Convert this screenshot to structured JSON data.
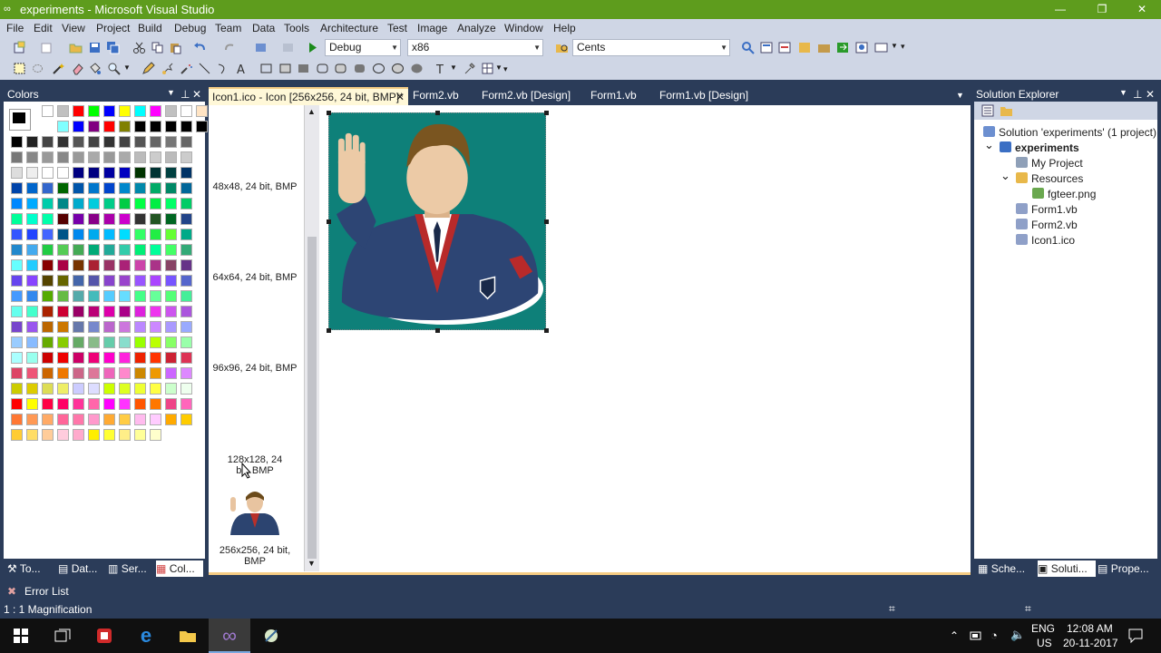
{
  "window": {
    "title": "experiments - Microsoft Visual Studio",
    "logo_icon": "vs-infinity-icon",
    "controls": {
      "minimize": "—",
      "restore": "❐",
      "close": "✕"
    }
  },
  "menu": [
    "File",
    "Edit",
    "View",
    "Project",
    "Build",
    "Debug",
    "Team",
    "Data",
    "Tools",
    "Architecture",
    "Test",
    "Image",
    "Analyze",
    "Window",
    "Help"
  ],
  "toolbar": {
    "config": "Debug",
    "platform": "x86",
    "find": "Cents"
  },
  "colors_panel": {
    "title": "Colors",
    "foreground": "#000000",
    "background": "#ffffff",
    "tabs": [
      "To...",
      "Dat...",
      "Ser...",
      "Col..."
    ],
    "palette": [
      [
        "#ffffff",
        "#c0c0c0",
        "#ff0000",
        "#00ff00",
        "#0000ff",
        "#ffff00",
        "#00ffff",
        "#ff00ff",
        "#c0c0c0",
        "#ffffff",
        "#ffe4c4"
      ],
      [
        "#80ffff",
        "#0000ff",
        "#800080",
        "#ff0000",
        "#808000",
        "#000000",
        "#000000",
        "#000000",
        "#000000",
        "#000000"
      ],
      [
        "#000000",
        "#222222",
        "#444444",
        "#333333",
        "#555555",
        "#444444",
        "#333333",
        "#444444",
        "#555555",
        "#666666",
        "#777777",
        "#666666"
      ],
      [
        "#777777",
        "#888888",
        "#999999",
        "#888888",
        "#999999",
        "#aaaaaa",
        "#999999",
        "#aaaaaa",
        "#bbbbbb",
        "#cccccc",
        "#bbbbbb",
        "#cccccc"
      ],
      [
        "#dddddd",
        "#eeeeee",
        "#ffffff",
        "#ffffff",
        "#000080",
        "#000080",
        "#0000a0",
        "#0000c0",
        "#003300",
        "#003333",
        "#004040",
        "#003366"
      ],
      [
        "#0044aa",
        "#0066cc",
        "#3366cc",
        "#006600",
        "#0055aa",
        "#0077cc",
        "#0044cc",
        "#0088cc",
        "#0088aa",
        "#00aa66",
        "#008866",
        "#006699"
      ],
      [
        "#0088ff",
        "#00aaff",
        "#00ccaa",
        "#008888",
        "#00aacc",
        "#00ccdd",
        "#00cc88",
        "#00cc44",
        "#00ff44",
        "#00ee44",
        "#00ff66",
        "#00cc66"
      ],
      [
        "#00ff99",
        "#00ffcc",
        "#00ffaa",
        "#550000",
        "#7700aa",
        "#880088",
        "#aa00aa",
        "#cc00cc",
        "#333333",
        "#225522",
        "#006622",
        "#224488"
      ],
      [
        "#3355ff",
        "#2244ff",
        "#4466ff",
        "#005588",
        "#0088ee",
        "#00aaee",
        "#00bbff",
        "#00ddff",
        "#33ff66",
        "#22ee44",
        "#66ff33",
        "#00aa88"
      ],
      [
        "#2288cc",
        "#44aaee",
        "#22cc44",
        "#55cc55",
        "#44aa55",
        "#00aa77",
        "#22aa99",
        "#33ccaa",
        "#00ee77",
        "#00ff99",
        "#44ff66",
        "#33aa77"
      ],
      [
        "#66ffff",
        "#22ccff",
        "#880000",
        "#aa0044",
        "#773300",
        "#aa2233",
        "#993366",
        "#aa2277",
        "#cc44aa",
        "#aa3388",
        "#884466",
        "#663388"
      ],
      [
        "#6644ee",
        "#8844ff",
        "#554400",
        "#666600",
        "#4466aa",
        "#5555aa",
        "#8844cc",
        "#9944cc",
        "#9955ff",
        "#aa44ff",
        "#7755ff",
        "#5566cc"
      ],
      [
        "#4499ff",
        "#3388ee",
        "#55aa00",
        "#66bb44",
        "#55aaaa",
        "#44bbbb",
        "#55ccff",
        "#66ddff",
        "#44ff88",
        "#66ff99",
        "#55ff77",
        "#44ee99"
      ],
      [
        "#66ffee",
        "#44ffcc",
        "#aa2200",
        "#cc0033",
        "#990066",
        "#bb0077",
        "#dd00aa",
        "#aa0088",
        "#dd22dd",
        "#ee33ee",
        "#cc55ee",
        "#aa55dd"
      ],
      [
        "#7744cc",
        "#9955ee",
        "#bb6600",
        "#cc7700",
        "#6677aa",
        "#7788cc",
        "#bb66cc",
        "#cc77dd",
        "#bb88ff",
        "#cc88ff",
        "#aa99ff",
        "#99aaff"
      ],
      [
        "#99ccff",
        "#88bbff",
        "#66aa00",
        "#88cc00",
        "#66aa66",
        "#88bb88",
        "#66ccaa",
        "#88ddcc",
        "#99ff00",
        "#bbff00",
        "#88ff66",
        "#99ffaa"
      ],
      [
        "#aaffff",
        "#99ffee",
        "#cc0000",
        "#ee0000",
        "#cc0066",
        "#ee0077",
        "#ff00cc",
        "#ff22dd",
        "#ee2200",
        "#ff3300",
        "#cc2233",
        "#dd3355"
      ],
      [
        "#dd4466",
        "#ee5577",
        "#cc6600",
        "#ee7700",
        "#cc6688",
        "#dd7799",
        "#ee66bb",
        "#ff88cc",
        "#cc8800",
        "#ee9900",
        "#cc66ff",
        "#dd88ff"
      ],
      [
        "#cccc00",
        "#ddcc00",
        "#dddd55",
        "#eeee66",
        "#ccccff",
        "#ddddff",
        "#ccff00",
        "#ddff22",
        "#eeff33",
        "#ffff44",
        "#ccffcc",
        "#eeffee"
      ],
      [
        "#ff0000",
        "#ffff00",
        "#ff0044",
        "#ff0066",
        "#ff3399",
        "#ff66aa",
        "#ff00ff",
        "#ff33ff",
        "#ff5500",
        "#ff7700",
        "#ee4488",
        "#ff66bb"
      ],
      [
        "#ff7733",
        "#ff9955",
        "#ffaa66",
        "#ff6699",
        "#ff77aa",
        "#ff99cc",
        "#ffaa33",
        "#ffcc44",
        "#ffbbee",
        "#ffccff",
        "#ffaa00",
        "#ffcc00"
      ],
      [
        "#ffcc33",
        "#ffdd66",
        "#ffcc99",
        "#ffccdd",
        "#ffaacc",
        "#ffee00",
        "#ffff33",
        "#ffee88",
        "#ffff99",
        "#ffffcc"
      ]
    ]
  },
  "doc_tabs": [
    {
      "label": "Icon1.ico - Icon [256x256, 24 bit, BMP]*",
      "active": true,
      "close": "✕"
    },
    {
      "label": "Form2.vb",
      "active": false
    },
    {
      "label": "Form2.vb [Design]",
      "active": false
    },
    {
      "label": "Form1.vb",
      "active": false
    },
    {
      "label": "Form1.vb [Design]",
      "active": false
    }
  ],
  "image_types": [
    "48x48, 24 bit, BMP",
    "64x64, 24 bit, BMP",
    "96x96, 24 bit, BMP",
    "128x128, 24 bit, BMP",
    "256x256, 24 bit, BMP"
  ],
  "solution_explorer": {
    "title": "Solution Explorer",
    "items": [
      {
        "label": "Solution 'experiments' (1 project)",
        "icon": "solution-icon",
        "bold": false
      },
      {
        "label": "experiments",
        "icon": "vb-project-icon",
        "bold": true
      },
      {
        "label": "My Project",
        "icon": "my-project-icon",
        "bold": false
      },
      {
        "label": "Resources",
        "icon": "folder-icon",
        "bold": false
      },
      {
        "label": "fgteer.png",
        "icon": "image-file-icon",
        "bold": false
      },
      {
        "label": "Form1.vb",
        "icon": "form-icon",
        "bold": false
      },
      {
        "label": "Form2.vb",
        "icon": "form-icon",
        "bold": false
      },
      {
        "label": "Icon1.ico",
        "icon": "icon-file-icon",
        "bold": false
      }
    ],
    "tabs": [
      "Sche...",
      "Soluti...",
      "Prope..."
    ]
  },
  "error_list": "Error List",
  "status": "1 : 1 Magnification",
  "taskbar": {
    "lang": "ENG",
    "region": "US",
    "time": "12:08 AM",
    "date": "20-11-2017"
  }
}
